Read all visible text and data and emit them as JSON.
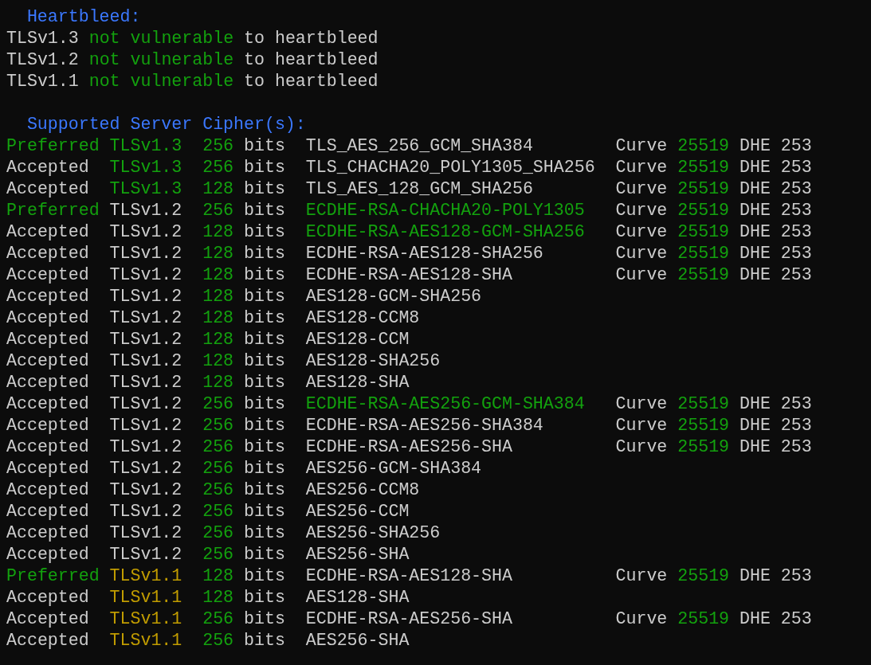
{
  "heartbleed": {
    "heading": "Heartbleed:",
    "lines": [
      {
        "protocol": "TLSv1.3",
        "status": "not vulnerable",
        "suffix": "to heartbleed"
      },
      {
        "protocol": "TLSv1.2",
        "status": "not vulnerable",
        "suffix": "to heartbleed"
      },
      {
        "protocol": "TLSv1.1",
        "status": "not vulnerable",
        "suffix": "to heartbleed"
      }
    ]
  },
  "ciphers": {
    "heading": "Supported Server Cipher(s):",
    "rows": [
      {
        "status": {
          "text": "Preferred",
          "color": "#13a10e"
        },
        "protocol": {
          "text": "TLSv1.3",
          "color": "#13a10e"
        },
        "bits": "256",
        "unit": "bits",
        "cipher": {
          "text": "TLS_AES_256_GCM_SHA384",
          "color": "#cccccc"
        },
        "curve": {
          "label": "Curve",
          "value": "25519",
          "dhe": "DHE 253"
        }
      },
      {
        "status": {
          "text": "Accepted",
          "color": "#cccccc"
        },
        "protocol": {
          "text": "TLSv1.3",
          "color": "#13a10e"
        },
        "bits": "256",
        "unit": "bits",
        "cipher": {
          "text": "TLS_CHACHA20_POLY1305_SHA256",
          "color": "#cccccc"
        },
        "curve": {
          "label": "Curve",
          "value": "25519",
          "dhe": "DHE 253"
        }
      },
      {
        "status": {
          "text": "Accepted",
          "color": "#cccccc"
        },
        "protocol": {
          "text": "TLSv1.3",
          "color": "#13a10e"
        },
        "bits": "128",
        "unit": "bits",
        "cipher": {
          "text": "TLS_AES_128_GCM_SHA256",
          "color": "#cccccc"
        },
        "curve": {
          "label": "Curve",
          "value": "25519",
          "dhe": "DHE 253"
        }
      },
      {
        "status": {
          "text": "Preferred",
          "color": "#13a10e"
        },
        "protocol": {
          "text": "TLSv1.2",
          "color": "#cccccc"
        },
        "bits": "256",
        "unit": "bits",
        "cipher": {
          "text": "ECDHE-RSA-CHACHA20-POLY1305",
          "color": "#13a10e"
        },
        "curve": {
          "label": "Curve",
          "value": "25519",
          "dhe": "DHE 253"
        }
      },
      {
        "status": {
          "text": "Accepted",
          "color": "#cccccc"
        },
        "protocol": {
          "text": "TLSv1.2",
          "color": "#cccccc"
        },
        "bits": "128",
        "unit": "bits",
        "cipher": {
          "text": "ECDHE-RSA-AES128-GCM-SHA256",
          "color": "#13a10e"
        },
        "curve": {
          "label": "Curve",
          "value": "25519",
          "dhe": "DHE 253"
        }
      },
      {
        "status": {
          "text": "Accepted",
          "color": "#cccccc"
        },
        "protocol": {
          "text": "TLSv1.2",
          "color": "#cccccc"
        },
        "bits": "128",
        "unit": "bits",
        "cipher": {
          "text": "ECDHE-RSA-AES128-SHA256",
          "color": "#cccccc"
        },
        "curve": {
          "label": "Curve",
          "value": "25519",
          "dhe": "DHE 253"
        }
      },
      {
        "status": {
          "text": "Accepted",
          "color": "#cccccc"
        },
        "protocol": {
          "text": "TLSv1.2",
          "color": "#cccccc"
        },
        "bits": "128",
        "unit": "bits",
        "cipher": {
          "text": "ECDHE-RSA-AES128-SHA",
          "color": "#cccccc"
        },
        "curve": {
          "label": "Curve",
          "value": "25519",
          "dhe": "DHE 253"
        }
      },
      {
        "status": {
          "text": "Accepted",
          "color": "#cccccc"
        },
        "protocol": {
          "text": "TLSv1.2",
          "color": "#cccccc"
        },
        "bits": "128",
        "unit": "bits",
        "cipher": {
          "text": "AES128-GCM-SHA256",
          "color": "#cccccc"
        }
      },
      {
        "status": {
          "text": "Accepted",
          "color": "#cccccc"
        },
        "protocol": {
          "text": "TLSv1.2",
          "color": "#cccccc"
        },
        "bits": "128",
        "unit": "bits",
        "cipher": {
          "text": "AES128-CCM8",
          "color": "#cccccc"
        }
      },
      {
        "status": {
          "text": "Accepted",
          "color": "#cccccc"
        },
        "protocol": {
          "text": "TLSv1.2",
          "color": "#cccccc"
        },
        "bits": "128",
        "unit": "bits",
        "cipher": {
          "text": "AES128-CCM",
          "color": "#cccccc"
        }
      },
      {
        "status": {
          "text": "Accepted",
          "color": "#cccccc"
        },
        "protocol": {
          "text": "TLSv1.2",
          "color": "#cccccc"
        },
        "bits": "128",
        "unit": "bits",
        "cipher": {
          "text": "AES128-SHA256",
          "color": "#cccccc"
        }
      },
      {
        "status": {
          "text": "Accepted",
          "color": "#cccccc"
        },
        "protocol": {
          "text": "TLSv1.2",
          "color": "#cccccc"
        },
        "bits": "128",
        "unit": "bits",
        "cipher": {
          "text": "AES128-SHA",
          "color": "#cccccc"
        }
      },
      {
        "status": {
          "text": "Accepted",
          "color": "#cccccc"
        },
        "protocol": {
          "text": "TLSv1.2",
          "color": "#cccccc"
        },
        "bits": "256",
        "unit": "bits",
        "cipher": {
          "text": "ECDHE-RSA-AES256-GCM-SHA384",
          "color": "#13a10e"
        },
        "curve": {
          "label": "Curve",
          "value": "25519",
          "dhe": "DHE 253"
        }
      },
      {
        "status": {
          "text": "Accepted",
          "color": "#cccccc"
        },
        "protocol": {
          "text": "TLSv1.2",
          "color": "#cccccc"
        },
        "bits": "256",
        "unit": "bits",
        "cipher": {
          "text": "ECDHE-RSA-AES256-SHA384",
          "color": "#cccccc"
        },
        "curve": {
          "label": "Curve",
          "value": "25519",
          "dhe": "DHE 253"
        }
      },
      {
        "status": {
          "text": "Accepted",
          "color": "#cccccc"
        },
        "protocol": {
          "text": "TLSv1.2",
          "color": "#cccccc"
        },
        "bits": "256",
        "unit": "bits",
        "cipher": {
          "text": "ECDHE-RSA-AES256-SHA",
          "color": "#cccccc"
        },
        "curve": {
          "label": "Curve",
          "value": "25519",
          "dhe": "DHE 253"
        }
      },
      {
        "status": {
          "text": "Accepted",
          "color": "#cccccc"
        },
        "protocol": {
          "text": "TLSv1.2",
          "color": "#cccccc"
        },
        "bits": "256",
        "unit": "bits",
        "cipher": {
          "text": "AES256-GCM-SHA384",
          "color": "#cccccc"
        }
      },
      {
        "status": {
          "text": "Accepted",
          "color": "#cccccc"
        },
        "protocol": {
          "text": "TLSv1.2",
          "color": "#cccccc"
        },
        "bits": "256",
        "unit": "bits",
        "cipher": {
          "text": "AES256-CCM8",
          "color": "#cccccc"
        }
      },
      {
        "status": {
          "text": "Accepted",
          "color": "#cccccc"
        },
        "protocol": {
          "text": "TLSv1.2",
          "color": "#cccccc"
        },
        "bits": "256",
        "unit": "bits",
        "cipher": {
          "text": "AES256-CCM",
          "color": "#cccccc"
        }
      },
      {
        "status": {
          "text": "Accepted",
          "color": "#cccccc"
        },
        "protocol": {
          "text": "TLSv1.2",
          "color": "#cccccc"
        },
        "bits": "256",
        "unit": "bits",
        "cipher": {
          "text": "AES256-SHA256",
          "color": "#cccccc"
        }
      },
      {
        "status": {
          "text": "Accepted",
          "color": "#cccccc"
        },
        "protocol": {
          "text": "TLSv1.2",
          "color": "#cccccc"
        },
        "bits": "256",
        "unit": "bits",
        "cipher": {
          "text": "AES256-SHA",
          "color": "#cccccc"
        }
      },
      {
        "status": {
          "text": "Preferred",
          "color": "#13a10e"
        },
        "protocol": {
          "text": "TLSv1.1",
          "color": "#c19c00"
        },
        "bits": "128",
        "unit": "bits",
        "cipher": {
          "text": "ECDHE-RSA-AES128-SHA",
          "color": "#cccccc"
        },
        "curve": {
          "label": "Curve",
          "value": "25519",
          "dhe": "DHE 253"
        }
      },
      {
        "status": {
          "text": "Accepted",
          "color": "#cccccc"
        },
        "protocol": {
          "text": "TLSv1.1",
          "color": "#c19c00"
        },
        "bits": "128",
        "unit": "bits",
        "cipher": {
          "text": "AES128-SHA",
          "color": "#cccccc"
        }
      },
      {
        "status": {
          "text": "Accepted",
          "color": "#cccccc"
        },
        "protocol": {
          "text": "TLSv1.1",
          "color": "#c19c00"
        },
        "bits": "256",
        "unit": "bits",
        "cipher": {
          "text": "ECDHE-RSA-AES256-SHA",
          "color": "#cccccc"
        },
        "curve": {
          "label": "Curve",
          "value": "25519",
          "dhe": "DHE 253"
        }
      },
      {
        "status": {
          "text": "Accepted",
          "color": "#cccccc"
        },
        "protocol": {
          "text": "TLSv1.1",
          "color": "#c19c00"
        },
        "bits": "256",
        "unit": "bits",
        "cipher": {
          "text": "AES256-SHA",
          "color": "#cccccc"
        }
      }
    ]
  }
}
